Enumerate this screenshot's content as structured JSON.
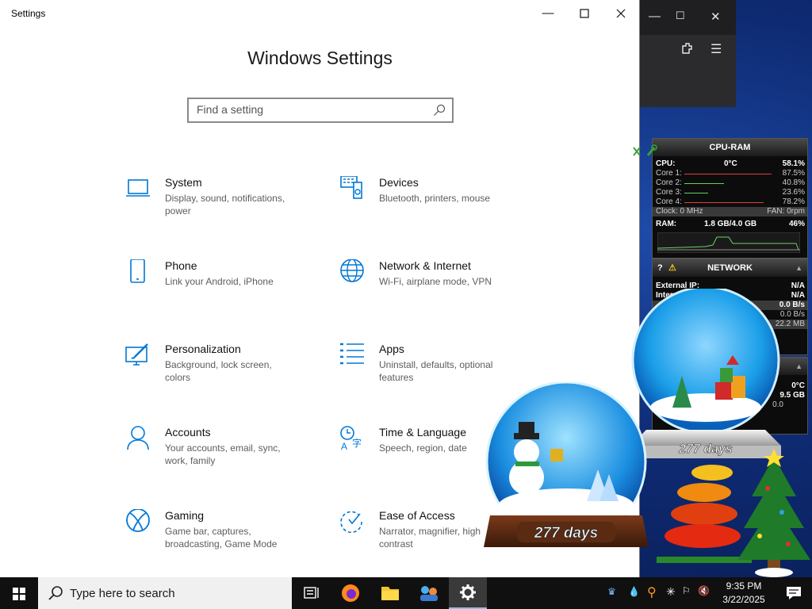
{
  "settings": {
    "window_title": "Settings",
    "page_title": "Windows Settings",
    "search_placeholder": "Find a setting",
    "tiles": [
      {
        "name": "System",
        "desc": "Display, sound, notifications, power"
      },
      {
        "name": "Devices",
        "desc": "Bluetooth, printers, mouse"
      },
      {
        "name": "Phone",
        "desc": "Link your Android, iPhone"
      },
      {
        "name": "Network & Internet",
        "desc": "Wi-Fi, airplane mode, VPN"
      },
      {
        "name": "Personalization",
        "desc": "Background, lock screen, colors"
      },
      {
        "name": "Apps",
        "desc": "Uninstall, defaults, optional features"
      },
      {
        "name": "Accounts",
        "desc": "Your accounts, email, sync, work, family"
      },
      {
        "name": "Time & Language",
        "desc": "Speech, region, date"
      },
      {
        "name": "Gaming",
        "desc": "Game bar, captures, broadcasting, Game Mode"
      },
      {
        "name": "Ease of Access",
        "desc": "Narrator, magnifier, high contrast"
      }
    ]
  },
  "cpu_gadget": {
    "title": "CPU-RAM",
    "cpu_label": "CPU:",
    "cpu_temp": "0°C",
    "cpu_value": "58.1%",
    "cores": [
      {
        "label": "Core 1:",
        "value": "87.5%"
      },
      {
        "label": "Core 2:",
        "value": "40.8%"
      },
      {
        "label": "Core 3:",
        "value": "23.6%"
      },
      {
        "label": "Core 4:",
        "value": "78.2%"
      }
    ],
    "clock_label": "Clock: 0 MHz",
    "fan_label": "FAN: 0rpm",
    "ram_label": "RAM:",
    "ram_value": "1.8 GB/4.0 GB",
    "ram_pct": "46%"
  },
  "network_gadget": {
    "title": "NETWORK",
    "external_ip_label": "External IP:",
    "external_ip_value": "N/A",
    "internal_label": "Interna",
    "internal_value": "N/A",
    "row3_value": "0.0 B/s",
    "row4_value": "0.0 B/s",
    "row5_value": "22.2 MB"
  },
  "hidden_gadget": {
    "temp": "0°C",
    "size": "9.5 GB",
    "value": "0.0"
  },
  "globes": {
    "left_days": "277 days",
    "right_days": "277 days"
  },
  "taskbar": {
    "search_text": "Type here to search",
    "time": "9:35 PM",
    "date": "3/22/2025"
  },
  "colors": {
    "accent": "#0078d7",
    "taskbar": "#101010"
  }
}
